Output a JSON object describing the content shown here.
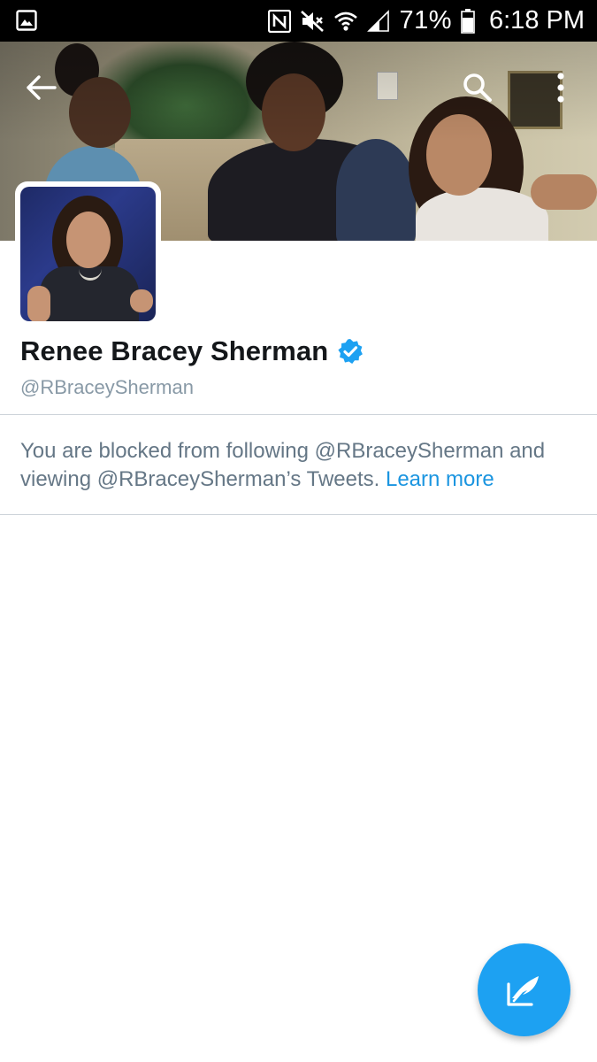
{
  "status_bar": {
    "battery_percent": "71%",
    "time": "6:18 PM",
    "icons": [
      "gallery-notification-icon",
      "nfc-icon",
      "mute-icon",
      "wifi-icon",
      "signal-icon",
      "battery-icon"
    ]
  },
  "header": {
    "back_icon": "arrow-left-icon",
    "search_icon": "search-icon",
    "more_icon": "more-vertical-icon"
  },
  "profile": {
    "name": "Renee Bracey Sherman",
    "handle": "@RBraceySherman",
    "verified": true,
    "verified_color": "#1da1f2"
  },
  "blocked_notice": {
    "text": "You are blocked from following @RBraceySherman and viewing @RBraceySherman’s Tweets.",
    "link_label": "Learn more",
    "link_color": "#1b95e0"
  },
  "compose": {
    "icon": "compose-tweet-icon",
    "color": "#1da1f2"
  }
}
